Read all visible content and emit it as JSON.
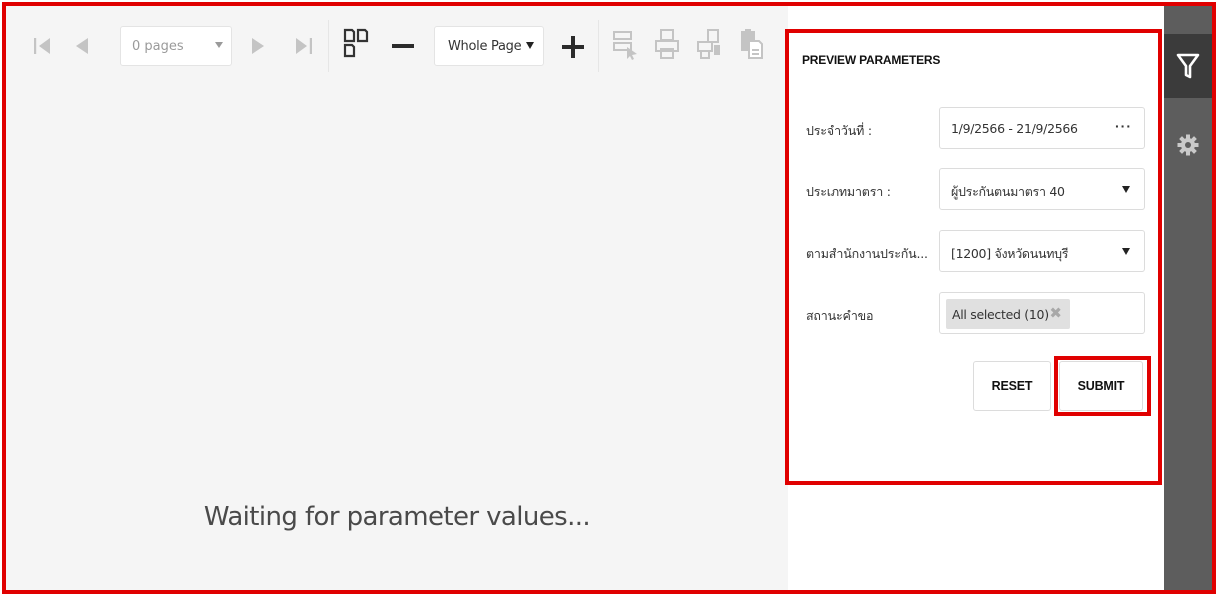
{
  "toolbar": {
    "pages_label": "0 pages",
    "zoom_label": "Whole Page",
    "icons": [
      "first-page-icon",
      "prev-page-icon",
      "next-page-icon",
      "last-page-icon",
      "multipage-icon",
      "zoom-out-icon",
      "zoom-in-icon",
      "highlight-fields-icon",
      "print-icon",
      "print-page-icon",
      "export-icon"
    ]
  },
  "viewer": {
    "status_text": "Waiting for parameter values..."
  },
  "params_panel": {
    "title": "PREVIEW PARAMETERS",
    "fields": [
      {
        "label": "ประจำวันที่ :",
        "value": "1/9/2566 - 21/9/2566",
        "control": "range-picker"
      },
      {
        "label": "ประเภทมาตรา :",
        "value": "ผู้ประกันตนมาตรา 40",
        "control": "dropdown"
      },
      {
        "label": "ตามสำนักงานประกัน...",
        "value": "[1200] จังหวัดนนทบุรี",
        "control": "dropdown"
      },
      {
        "label": "สถานะคำขอ",
        "value": "All selected (10)",
        "control": "tag-box"
      }
    ],
    "reset_label": "RESET",
    "submit_label": "SUBMIT"
  },
  "tabs": {
    "icons": [
      "parameters-tab-icon",
      "settings-tab-icon"
    ]
  },
  "colors": {
    "annotation_red": "#e00000",
    "viewer_bg": "#f5f5f5",
    "tab_strip": "#5d5d5d",
    "tab_active": "#3b3b3b",
    "icon_disabled": "#c4c4c4"
  }
}
